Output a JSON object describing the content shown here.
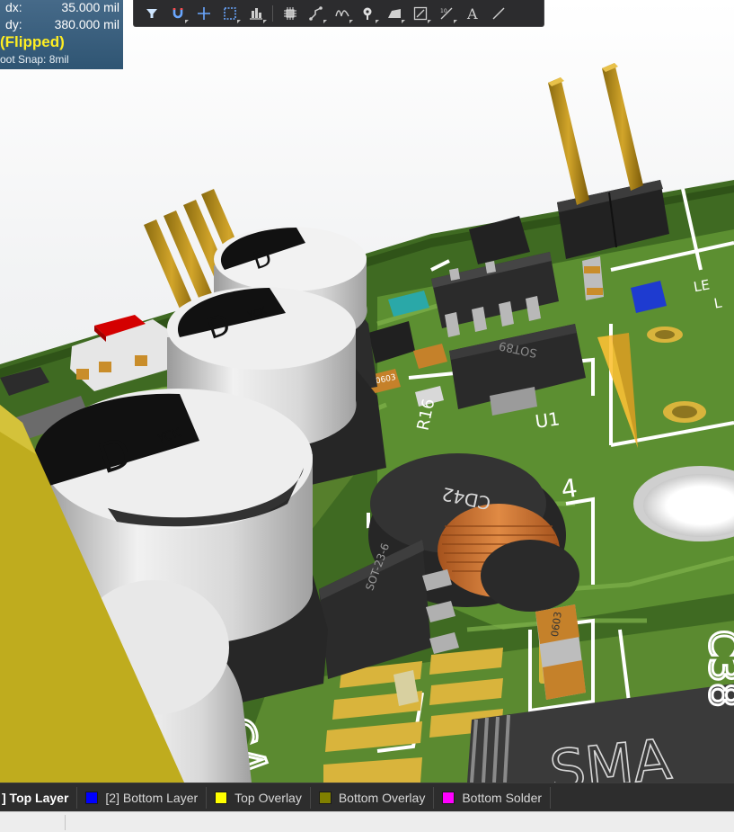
{
  "hud": {
    "dx_label": "dx:",
    "dx_value": "35.000  mil",
    "dy_label": "dy:",
    "dy_value": "380.000 mil",
    "flipped": "(Flipped)",
    "snap": "oot Snap: 8mil"
  },
  "toolbar": {
    "buttons": [
      {
        "name": "filter-icon"
      },
      {
        "name": "snap-magnet-icon"
      },
      {
        "name": "crosshair-icon"
      },
      {
        "name": "select-rectangle-icon"
      },
      {
        "name": "align-icon"
      },
      {
        "name": "component-icon"
      },
      {
        "name": "route-icon"
      },
      {
        "name": "interactive-diff-pair-icon"
      },
      {
        "name": "place-pad-icon"
      },
      {
        "name": "polygon-icon"
      },
      {
        "name": "dimension-icon"
      },
      {
        "name": "length-tuning-icon"
      },
      {
        "name": "text-icon",
        "glyph": "A"
      },
      {
        "name": "line-icon"
      }
    ]
  },
  "board": {
    "labels": {
      "cd42": "CD42",
      "sot23": "SOT-23-6",
      "sot89": "SOT89",
      "cap_0603_a": "0603",
      "cap_0603_b": "0603",
      "u1": "U1",
      "r16": "R16",
      "c38": "C38",
      "c4": "C4",
      "sma": "SMA",
      "four": "4",
      "yck": "YCK",
      "d_mark": "D",
      "led_a": "LE",
      "led_b": "L"
    }
  },
  "layers": {
    "tabs": [
      {
        "label": "] Top Layer",
        "color": "",
        "active": true
      },
      {
        "label": "[2] Bottom Layer",
        "color": "#0000ff",
        "active": false
      },
      {
        "label": "Top Overlay",
        "color": "#ffff00",
        "active": false
      },
      {
        "label": "Bottom Overlay",
        "color": "#808000",
        "active": false
      },
      {
        "label": "Bottom Solder",
        "color": "#ff00ff",
        "active": false
      }
    ]
  },
  "colors": {
    "pcb_green": "#4a7a2a",
    "trace_green": "#6fa03d",
    "silk": "#ffffff",
    "gold": "#c8a800",
    "copper": "#d2b23a"
  }
}
